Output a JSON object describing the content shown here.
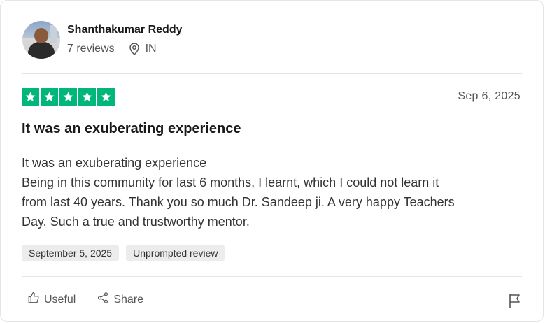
{
  "reviewer": {
    "name": "Shanthakumar Reddy",
    "reviews_count": "7 reviews",
    "location": "IN"
  },
  "review": {
    "rating": 5,
    "date": "Sep 6, 2025",
    "title": "It was an exuberating experience",
    "body_lines": [
      "It was an exuberating experience",
      "Being in this community for last 6 months, I learnt, which I could not learn it",
      "from last 40 years. Thank you so much Dr. Sandeep ji. A very happy Teachers",
      "Day. Such a true and trustworthy mentor."
    ],
    "experience_date": "September 5, 2025",
    "review_type": "Unprompted review"
  },
  "actions": {
    "useful_label": "Useful",
    "share_label": "Share"
  },
  "colors": {
    "star_green": "#00b67a",
    "badge_bg": "#ececec",
    "divider": "#e5e5e5"
  },
  "icons": [
    "location-pin-icon",
    "star-icon",
    "thumbs-up-icon",
    "share-icon",
    "flag-icon"
  ]
}
